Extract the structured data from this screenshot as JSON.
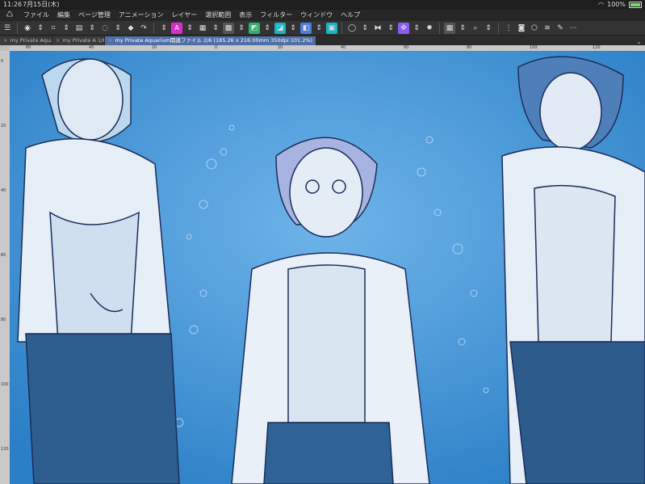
{
  "status": {
    "time": "11:26",
    "date": "7月15日(木)",
    "battery": "100%"
  },
  "menu": {
    "items": [
      "ファイル",
      "編集",
      "ページ管理",
      "アニメーション",
      "レイヤー",
      "選択範囲",
      "表示",
      "フィルター",
      "ウィンドウ",
      "ヘルプ"
    ]
  },
  "toolbar": {
    "buttons": [
      {
        "name": "hamburger-icon",
        "glyph": "☰",
        "cls": ""
      },
      {
        "name": "sep",
        "cls": "sep"
      },
      {
        "name": "record-icon",
        "glyph": "◉",
        "cls": ""
      },
      {
        "name": "arrows-icon",
        "glyph": "⇕",
        "cls": ""
      },
      {
        "name": "crop-icon",
        "glyph": "⌗",
        "cls": ""
      },
      {
        "name": "arrows-icon",
        "glyph": "⇕",
        "cls": ""
      },
      {
        "name": "print-icon",
        "glyph": "▤",
        "cls": ""
      },
      {
        "name": "arrows-icon",
        "glyph": "⇕",
        "cls": ""
      },
      {
        "name": "lasso-icon",
        "glyph": "◌",
        "cls": ""
      },
      {
        "name": "arrows-icon",
        "glyph": "⇕",
        "cls": ""
      },
      {
        "name": "stamp-icon",
        "glyph": "◆",
        "cls": ""
      },
      {
        "name": "redo-icon",
        "glyph": "↷",
        "cls": ""
      },
      {
        "name": "sep",
        "cls": "sep"
      },
      {
        "name": "arrows-icon",
        "glyph": "⇕",
        "cls": ""
      },
      {
        "name": "text-icon",
        "glyph": "A",
        "cls": "pink"
      },
      {
        "name": "arrows-icon",
        "glyph": "⇕",
        "cls": ""
      },
      {
        "name": "layout-icon",
        "glyph": "▦",
        "cls": ""
      },
      {
        "name": "arrows-icon",
        "glyph": "⇕",
        "cls": ""
      },
      {
        "name": "image-icon",
        "glyph": "▩",
        "cls": "gray"
      },
      {
        "name": "arrows-icon",
        "glyph": "⇕",
        "cls": ""
      },
      {
        "name": "fill-icon",
        "glyph": "◩",
        "cls": "green"
      },
      {
        "name": "arrows-icon",
        "glyph": "⇕",
        "cls": ""
      },
      {
        "name": "color-icon",
        "glyph": "◪",
        "cls": "teal"
      },
      {
        "name": "arrows-icon",
        "glyph": "⇕",
        "cls": ""
      },
      {
        "name": "layer-icon",
        "glyph": "◧",
        "cls": "blue"
      },
      {
        "name": "arrows-icon",
        "glyph": "⇕",
        "cls": ""
      },
      {
        "name": "frame-icon",
        "glyph": "▣",
        "cls": "teal"
      },
      {
        "name": "sep",
        "cls": "sep"
      },
      {
        "name": "lasso-select-icon",
        "glyph": "◯",
        "cls": ""
      },
      {
        "name": "arrows-icon",
        "glyph": "⇕",
        "cls": ""
      },
      {
        "name": "flip-icon",
        "glyph": "⧓",
        "cls": ""
      },
      {
        "name": "arrows-icon",
        "glyph": "⇕",
        "cls": ""
      },
      {
        "name": "transform-icon",
        "glyph": "✥",
        "cls": "violet"
      },
      {
        "name": "arrows-icon",
        "glyph": "⇕",
        "cls": ""
      },
      {
        "name": "gear-icon",
        "glyph": "✹",
        "cls": ""
      },
      {
        "name": "sep",
        "cls": "sep"
      },
      {
        "name": "grid-icon",
        "glyph": "▦",
        "cls": "gray"
      },
      {
        "name": "arrows-icon",
        "glyph": "⇕",
        "cls": ""
      },
      {
        "name": "search-icon",
        "glyph": "⌕",
        "cls": ""
      },
      {
        "name": "arrows-icon",
        "glyph": "⇕",
        "cls": ""
      },
      {
        "name": "sep",
        "cls": "sep"
      },
      {
        "name": "drag-icon",
        "glyph": "⋮",
        "cls": ""
      },
      {
        "name": "camera-icon",
        "glyph": "◙",
        "cls": ""
      },
      {
        "name": "bucket-icon",
        "glyph": "⬡",
        "cls": ""
      },
      {
        "name": "stack-icon",
        "glyph": "≋",
        "cls": ""
      },
      {
        "name": "pen-icon",
        "glyph": "✎",
        "cls": ""
      },
      {
        "name": "menu-dots-icon",
        "glyph": "⋯",
        "cls": ""
      }
    ]
  },
  "tabs": [
    {
      "label": "my Private Aqua",
      "active": false
    },
    {
      "label": "my Private A 1/6",
      "active": false
    },
    {
      "label": "my Private Aquarium関連ファイル 2/6 (185.26 x 216.00mm 350dpi 101.2%)",
      "active": true
    }
  ],
  "ruler": {
    "top_ticks": [
      "60",
      "40",
      "20",
      "0",
      "20",
      "40",
      "60",
      "80",
      "100",
      "120"
    ],
    "left_ticks": [
      "0",
      "20",
      "40",
      "60",
      "80",
      "100",
      "120"
    ]
  }
}
